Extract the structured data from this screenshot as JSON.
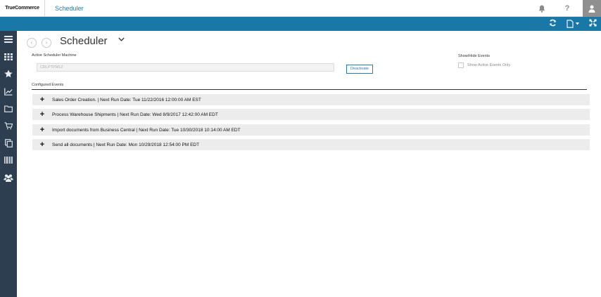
{
  "header": {
    "logo": "TrueCommerce",
    "app_name": "Scheduler"
  },
  "page": {
    "title": "Scheduler"
  },
  "machine": {
    "label": "Active Scheduler Machine",
    "value": "CRLPTPM12",
    "deactivate_label": "Deactivate"
  },
  "events_filter": {
    "label": "Show/Hide Events",
    "checkbox_label": "Show Active Events Only",
    "checked": false
  },
  "configured": {
    "label": "Configured Events",
    "events": [
      {
        "text": "Sales Order Creation. | Next Run Date: Tue 11/22/2016 12:00:00 AM EST"
      },
      {
        "text": "Process Warehouse Shipments | Next Run Date: Wed 8/9/2017 12:42:00 AM EDT"
      },
      {
        "text": "Import documents from Business Central | Next Run Date: Tue 10/30/2018 10:14:00 AM EDT"
      },
      {
        "text": "Send all documents | Next Run Date: Mon 10/29/2018 12:54:00 PM EDT"
      }
    ]
  },
  "colors": {
    "accent": "#1a78a8",
    "sidebar": "#2c3e50",
    "row": "#ececec"
  }
}
